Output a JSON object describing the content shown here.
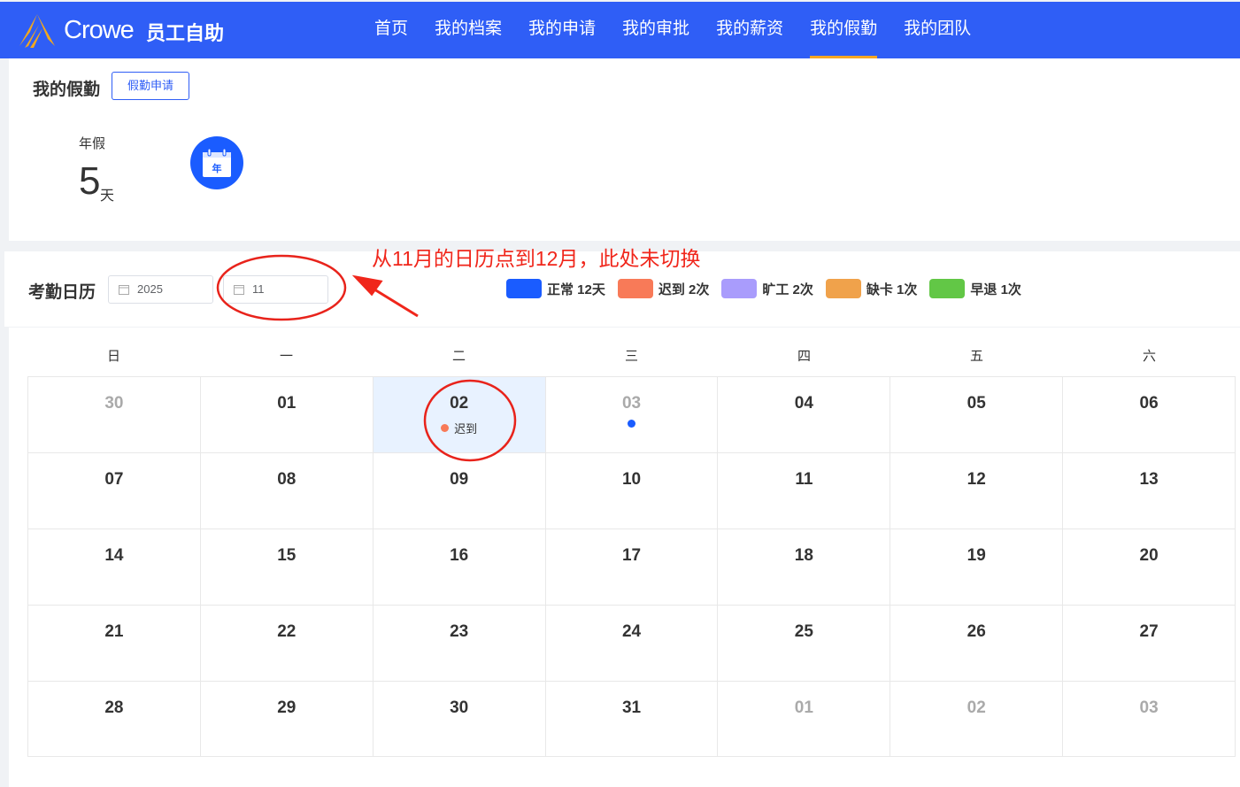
{
  "header": {
    "brand": "Crowe",
    "subtitle": "员工自助",
    "menu": [
      "首页",
      "我的档案",
      "我的申请",
      "我的审批",
      "我的薪资",
      "我的假勤",
      "我的团队"
    ],
    "active": 5
  },
  "leave": {
    "title": "我的假勤",
    "apply_button": "假勤申请",
    "annual_label": "年假",
    "annual_value": "5",
    "annual_unit": "天",
    "icon_text": "年"
  },
  "calendar": {
    "title": "考勤日历",
    "year": "2025",
    "month": "11",
    "legend": [
      {
        "label": "正常 12天",
        "color": "#1a5cff"
      },
      {
        "label": "迟到 2次",
        "color": "#f87a58"
      },
      {
        "label": "旷工 2次",
        "color": "#a99cfc"
      },
      {
        "label": "缺卡 1次",
        "color": "#f0a24b"
      },
      {
        "label": "早退 1次",
        "color": "#62c746"
      }
    ],
    "weekdays": [
      "日",
      "一",
      "二",
      "三",
      "四",
      "五",
      "六"
    ],
    "weeks": [
      [
        {
          "d": "30",
          "o": true
        },
        {
          "d": "01"
        },
        {
          "d": "02",
          "sel": true,
          "mark": "迟到",
          "c": "#f87a58"
        },
        {
          "d": "03",
          "o": true,
          "c": "#1a5cff"
        },
        {
          "d": "04"
        },
        {
          "d": "05"
        },
        {
          "d": "06"
        }
      ],
      [
        {
          "d": "07"
        },
        {
          "d": "08"
        },
        {
          "d": "09"
        },
        {
          "d": "10"
        },
        {
          "d": "11"
        },
        {
          "d": "12"
        },
        {
          "d": "13"
        }
      ],
      [
        {
          "d": "14"
        },
        {
          "d": "15"
        },
        {
          "d": "16"
        },
        {
          "d": "17"
        },
        {
          "d": "18"
        },
        {
          "d": "19"
        },
        {
          "d": "20"
        }
      ],
      [
        {
          "d": "21"
        },
        {
          "d": "22"
        },
        {
          "d": "23"
        },
        {
          "d": "24"
        },
        {
          "d": "25"
        },
        {
          "d": "26"
        },
        {
          "d": "27"
        }
      ],
      [
        {
          "d": "28"
        },
        {
          "d": "29"
        },
        {
          "d": "30"
        },
        {
          "d": "31"
        },
        {
          "d": "01",
          "o": true
        },
        {
          "d": "02",
          "o": true
        },
        {
          "d": "03",
          "o": true
        }
      ]
    ]
  },
  "annotation": "从11月的日历点到12月，此处未切换"
}
